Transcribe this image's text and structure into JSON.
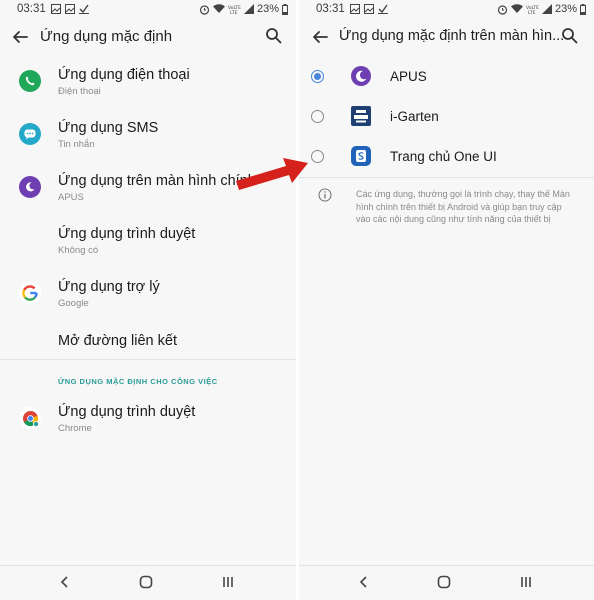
{
  "left": {
    "status": {
      "time": "03:31",
      "battery": "23%"
    },
    "title": "Ứng dụng mặc định",
    "items": [
      {
        "title": "Ứng dụng điện thoại",
        "subtitle": "Điện thoại",
        "icon": "phone-icon"
      },
      {
        "title": "Ứng dụng SMS",
        "subtitle": "Tin nhắn",
        "icon": "messages-icon"
      },
      {
        "title": "Ứng dụng trên màn hình chính",
        "subtitle": "APUS",
        "icon": "apus-icon"
      },
      {
        "title": "Ứng dụng trình duyệt",
        "subtitle": "Không có",
        "icon": ""
      },
      {
        "title": "Ứng dụng trợ lý",
        "subtitle": "Google",
        "icon": "google-icon"
      },
      {
        "title": "Mở đường liên kết",
        "subtitle": "",
        "icon": ""
      }
    ],
    "work_section": {
      "header": "ỨNG DỤNG MẶC ĐỊNH CHO CÔNG VIỆC",
      "items": [
        {
          "title": "Ứng dụng trình duyệt",
          "subtitle": "Chrome",
          "icon": "chrome-icon"
        }
      ]
    }
  },
  "right": {
    "status": {
      "time": "03:31",
      "battery": "23%"
    },
    "title": "Ứng dụng mặc định trên màn hìn...",
    "options": [
      {
        "label": "APUS",
        "selected": true,
        "icon": "apus-icon"
      },
      {
        "label": "i-Garten",
        "selected": false,
        "icon": "i-garten-icon"
      },
      {
        "label": "Trang chủ One UI",
        "selected": false,
        "icon": "one-ui-home-icon"
      }
    ],
    "info_text": "Các ứng dụng, thường gọi là trình chạy, thay thế Màn hình chính trên thiết bị Android và giúp bạn truy cập vào các nội dung cũng như tính năng của thiết bị"
  },
  "colors": {
    "accent_teal": "#2c9c97",
    "radio_selected": "#4a86d8",
    "annotation_arrow": "#d6201c",
    "phone_icon_bg": "#1fa85a",
    "sms_icon_bg": "#26a8c9",
    "apus_icon_bg": "#6d3fb3",
    "i_garten_icon_bg": "#1d3f73",
    "one_ui_icon_bg": "#1f64b8"
  }
}
